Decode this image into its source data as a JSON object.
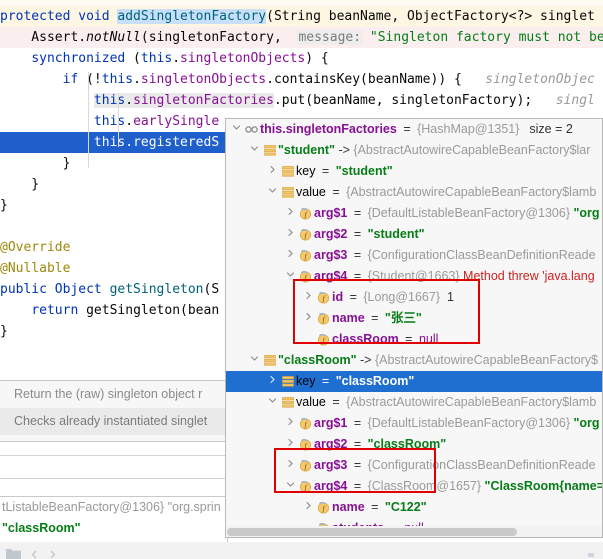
{
  "editor": {
    "lines": [
      {
        "id": "l1",
        "bg": "yellow",
        "segments": [
          {
            "t": "protected void ",
            "c": "kw"
          },
          {
            "t": "addSingletonFactory",
            "c": "meth sel"
          },
          {
            "t": "(String beanName, ObjectFactory<?> singlet",
            "c": "plain"
          }
        ]
      },
      {
        "id": "l2",
        "bg": "pink",
        "segments": [
          {
            "t": "    Assert.",
            "c": "plain"
          },
          {
            "t": "notNull",
            "c": "ital"
          },
          {
            "t": "(singletonFactory,  ",
            "c": "plain"
          },
          {
            "t": "message:",
            "c": "hintbg"
          },
          {
            "t": " ",
            "c": "plain"
          },
          {
            "t": "\"Singleton factory must not be",
            "c": "str"
          }
        ]
      },
      {
        "id": "l3",
        "bg": "none",
        "segments": [
          {
            "t": "    ",
            "c": "plain"
          },
          {
            "t": "synchronized",
            "c": "kw"
          },
          {
            "t": " (",
            "c": "plain"
          },
          {
            "t": "this",
            "c": "kw"
          },
          {
            "t": ".",
            "c": "plain"
          },
          {
            "t": "singletonObjects",
            "c": "fld"
          },
          {
            "t": ") {",
            "c": "plain"
          }
        ]
      },
      {
        "id": "l4",
        "bg": "none",
        "segments": [
          {
            "t": "        ",
            "c": "plain"
          },
          {
            "t": "if",
            "c": "kw"
          },
          {
            "t": " (!",
            "c": "plain"
          },
          {
            "t": "this",
            "c": "kw"
          },
          {
            "t": ".",
            "c": "plain"
          },
          {
            "t": "singletonObjects",
            "c": "fld"
          },
          {
            "t": ".containsKey(beanName)) {   ",
            "c": "plain"
          },
          {
            "t": "singletonObjec",
            "c": "hint"
          }
        ]
      },
      {
        "id": "l5",
        "bg": "none",
        "segments": [
          {
            "t": "            ",
            "c": "plain"
          },
          {
            "t": "this",
            "c": "kw softbg"
          },
          {
            "t": ".",
            "c": "plain softbg"
          },
          {
            "t": "singletonFactories",
            "c": "fld softbg"
          },
          {
            "t": ".put(beanName, singletonFactory);   ",
            "c": "plain"
          },
          {
            "t": "singl",
            "c": "hint"
          }
        ]
      },
      {
        "id": "l6",
        "bg": "none",
        "segments": [
          {
            "t": "            ",
            "c": "plain"
          },
          {
            "t": "this",
            "c": "kw"
          },
          {
            "t": ".",
            "c": "plain"
          },
          {
            "t": "earlySingle",
            "c": "fld"
          }
        ]
      },
      {
        "id": "l7",
        "bg": "blue",
        "segments": [
          {
            "t": "            ",
            "c": "white"
          },
          {
            "t": "this",
            "c": "white"
          },
          {
            "t": ".",
            "c": "white"
          },
          {
            "t": "registeredS",
            "c": "white"
          }
        ]
      },
      {
        "id": "l8",
        "bg": "none",
        "segments": [
          {
            "t": "        }",
            "c": "plain"
          }
        ]
      },
      {
        "id": "l9",
        "bg": "none",
        "segments": [
          {
            "t": "    }",
            "c": "plain"
          }
        ]
      },
      {
        "id": "l10",
        "bg": "none",
        "segments": [
          {
            "t": "}",
            "c": "plain"
          }
        ]
      },
      {
        "id": "l11",
        "bg": "none",
        "segments": [
          {
            "t": "",
            "c": "plain"
          }
        ]
      },
      {
        "id": "l12",
        "bg": "none",
        "segments": [
          {
            "t": "@Override",
            "c": "anno"
          }
        ]
      },
      {
        "id": "l13",
        "bg": "none",
        "segments": [
          {
            "t": "@Nullable",
            "c": "anno"
          }
        ]
      },
      {
        "id": "l14",
        "bg": "none",
        "segments": [
          {
            "t": "public Object ",
            "c": "kw"
          },
          {
            "t": "getSingleton",
            "c": "meth"
          },
          {
            "t": "(S",
            "c": "plain"
          }
        ]
      },
      {
        "id": "l15",
        "bg": "none",
        "segments": [
          {
            "t": "    ",
            "c": "plain"
          },
          {
            "t": "return",
            "c": "kw"
          },
          {
            "t": " getSingleton(bean",
            "c": "plain"
          }
        ]
      },
      {
        "id": "l16",
        "bg": "none",
        "segments": [
          {
            "t": "}",
            "c": "plain"
          }
        ]
      }
    ]
  },
  "doc_popup": {
    "line1": "Return the (raw) singleton object r",
    "line2": "Checks already instantiated singlet"
  },
  "bg_variables": {
    "row1": "tListableBeanFactory@1306} \"org.sprin",
    "row2": "\"classRoom\""
  },
  "debugger": {
    "rows": [
      {
        "indent": 0,
        "chev": "down",
        "icon": "watch-icon",
        "name": "this.singletonFactories",
        "eq": "=",
        "type": "{HashMap@1351}",
        "extra": "size = 2",
        "selected": false,
        "nameclass": "vtop"
      },
      {
        "indent": 1,
        "chev": "down",
        "icon": "entry-icon",
        "str": "\"student\"",
        "arrow": "->",
        "type": "{AbstractAutowireCapableBeanFactory$lar",
        "selected": false
      },
      {
        "indent": 2,
        "chev": "right",
        "icon": "entry-icon",
        "name": "key",
        "eq": "=",
        "str": "\"student\"",
        "selected": false,
        "nameclass": "key"
      },
      {
        "indent": 2,
        "chev": "down",
        "icon": "entry-icon",
        "name": "value",
        "eq": "=",
        "type": "{AbstractAutowireCapableBeanFactory$lamb",
        "selected": false,
        "nameclass": "key"
      },
      {
        "indent": 3,
        "chev": "right",
        "icon": "field-icon",
        "name": "arg$1",
        "eq": "=",
        "type": "{DefaultListableBeanFactory@1306}",
        "str": "\"org",
        "selected": false
      },
      {
        "indent": 3,
        "chev": "right",
        "icon": "field-icon",
        "name": "arg$2",
        "eq": "=",
        "str": "\"student\"",
        "selected": false
      },
      {
        "indent": 3,
        "chev": "right",
        "icon": "field-icon",
        "name": "arg$3",
        "eq": "=",
        "type": "{ConfigurationClassBeanDefinitionReade",
        "selected": false
      },
      {
        "indent": 3,
        "chev": "down",
        "icon": "field-icon",
        "name": "arg$4",
        "eq": "=",
        "type": "{Student@1663}",
        "err": "Method threw 'java.lang",
        "selected": false
      },
      {
        "indent": 4,
        "chev": "right",
        "icon": "field-icon",
        "name": "id",
        "eq": "=",
        "type": "{Long@1667}",
        "num": "1",
        "selected": false
      },
      {
        "indent": 4,
        "chev": "right",
        "icon": "field-icon",
        "name": "name",
        "eq": "=",
        "str": "\"张三\"",
        "selected": false
      },
      {
        "indent": 4,
        "chev": "none",
        "icon": "field-icon",
        "name": "classRoom",
        "eq": "=",
        "nullval": "null",
        "selected": false
      },
      {
        "indent": 1,
        "chev": "down",
        "icon": "entry-icon",
        "str": "\"classRoom\"",
        "arrow": "->",
        "type": "{AbstractAutowireCapableBeanFactory$",
        "selected": false
      },
      {
        "indent": 2,
        "chev": "right",
        "icon": "entry-icon",
        "name": "key",
        "eq": "=",
        "str": "\"classRoom\"",
        "selected": true,
        "nameclass": "key"
      },
      {
        "indent": 2,
        "chev": "down",
        "icon": "entry-icon",
        "name": "value",
        "eq": "=",
        "type": "{AbstractAutowireCapableBeanFactory$lamb",
        "selected": false,
        "nameclass": "key"
      },
      {
        "indent": 3,
        "chev": "right",
        "icon": "field-icon",
        "name": "arg$1",
        "eq": "=",
        "type": "{DefaultListableBeanFactory@1306}",
        "str": "\"org",
        "selected": false
      },
      {
        "indent": 3,
        "chev": "right",
        "icon": "field-icon",
        "name": "arg$2",
        "eq": "=",
        "str": "\"classRoom\"",
        "selected": false
      },
      {
        "indent": 3,
        "chev": "right",
        "icon": "field-icon",
        "name": "arg$3",
        "eq": "=",
        "type": "{ConfigurationClassBeanDefinitionReade",
        "selected": false
      },
      {
        "indent": 3,
        "chev": "down",
        "icon": "field-icon",
        "name": "arg$4",
        "eq": "=",
        "type": "{ClassRoom@1657}",
        "str": "\"ClassRoom{name=",
        "selected": false
      },
      {
        "indent": 4,
        "chev": "right",
        "icon": "field-icon",
        "name": "name",
        "eq": "=",
        "str": "\"C122\"",
        "selected": false
      },
      {
        "indent": 4,
        "chev": "none",
        "icon": "field-icon",
        "name": "students",
        "eq": "=",
        "nullval": "null",
        "selected": false
      }
    ]
  },
  "annotations": {
    "box1_label": "student-fields-highlight",
    "box2_label": "classroom-fields-highlight",
    "color": "#e00000"
  },
  "colors": {
    "selection_blue": "#1f6fd0",
    "editor_exec_line": "#1f5fcc",
    "string_green": "#067d17",
    "field_purple": "#871094",
    "keyword_blue": "#0033b3",
    "error_red": "#cc2222"
  }
}
